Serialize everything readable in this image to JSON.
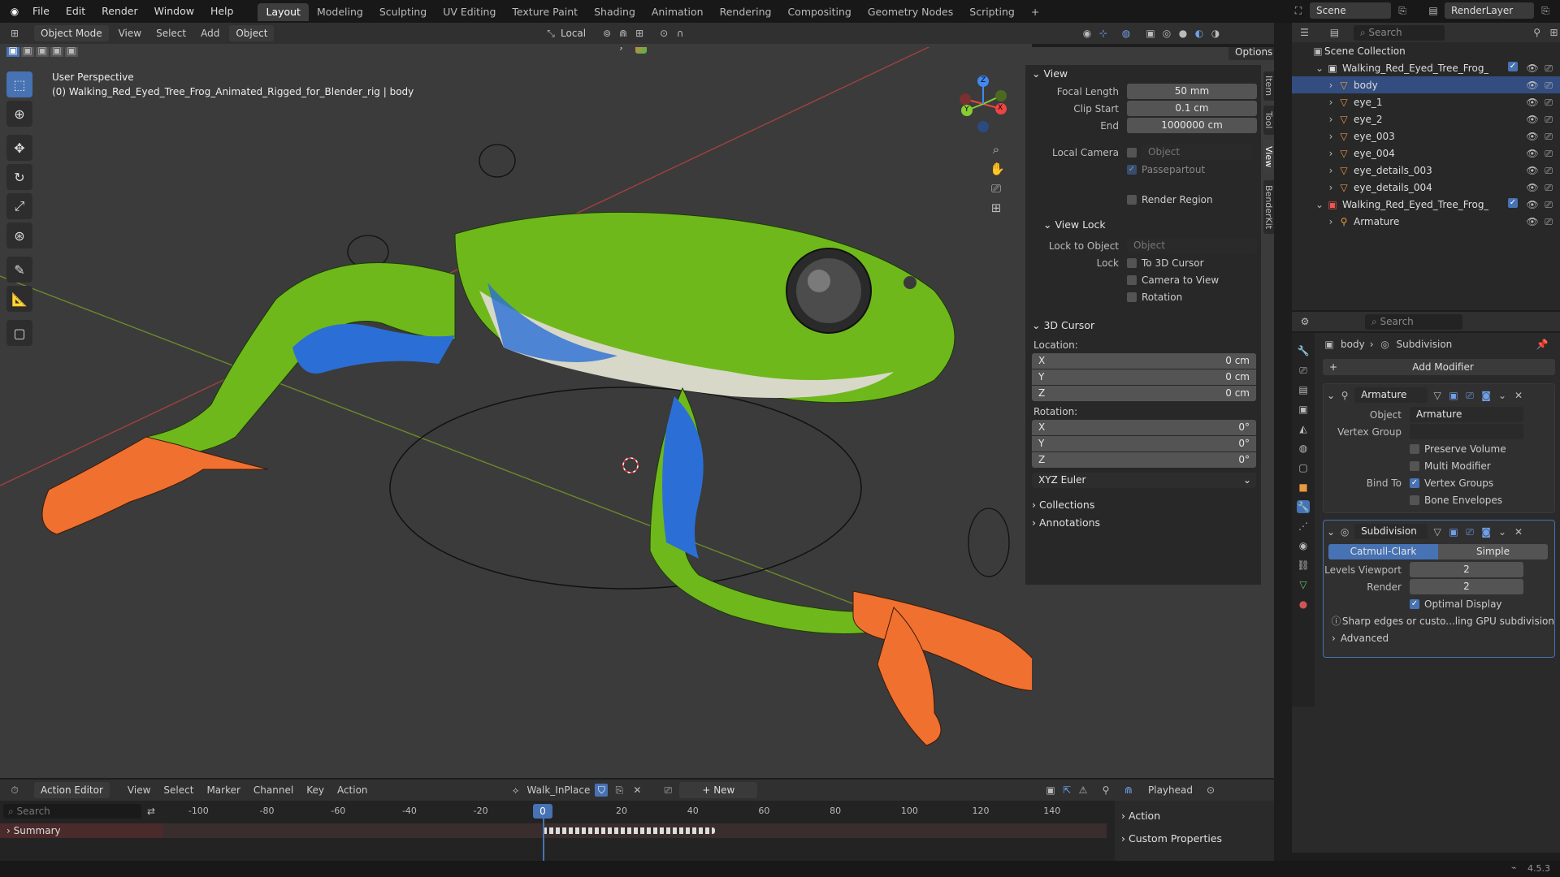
{
  "topbar": {
    "menus": [
      "File",
      "Edit",
      "Render",
      "Window",
      "Help"
    ],
    "workspaces": [
      "Layout",
      "Modeling",
      "Sculpting",
      "UV Editing",
      "Texture Paint",
      "Shading",
      "Animation",
      "Rendering",
      "Compositing",
      "Geometry Nodes",
      "Scripting"
    ],
    "active_workspace": "Layout",
    "add_tab": "+",
    "scene": "Scene",
    "view_layer": "RenderLayer"
  },
  "viewport_header": {
    "mode": "Object Mode",
    "menus": [
      "View",
      "Select",
      "Add",
      "Object"
    ],
    "active_menu": "Object",
    "transform_orientation": "Local",
    "options": "Options"
  },
  "viewport": {
    "perspective": "User Perspective",
    "object_info": "(0) Walking_Red_Eyed_Tree_Frog_Animated_Rigged_for_Blender_rig | body",
    "gizmo_axes": [
      "X",
      "Y",
      "Z"
    ]
  },
  "npanel": {
    "tabs": [
      "Item",
      "Tool",
      "View",
      "BenderKit"
    ],
    "view": {
      "title": "View",
      "focal_length_label": "Focal Length",
      "focal_length": "50 mm",
      "clip_start_label": "Clip Start",
      "clip_start": "0.1 cm",
      "end_label": "End",
      "end": "1000000 cm",
      "local_camera_label": "Local Camera",
      "object_placeholder": "Object",
      "passepartout": "Passepartout",
      "render_region": "Render Region"
    },
    "view_lock": {
      "title": "View Lock",
      "lock_to_object_label": "Lock to Object",
      "object_placeholder": "Object",
      "lock_label": "Lock",
      "to_3d_cursor": "To 3D Cursor",
      "camera_to_view": "Camera to View",
      "rotation": "Rotation"
    },
    "cursor": {
      "title": "3D Cursor",
      "location_label": "Location:",
      "loc": [
        {
          "axis": "X",
          "value": "0 cm"
        },
        {
          "axis": "Y",
          "value": "0 cm"
        },
        {
          "axis": "Z",
          "value": "0 cm"
        }
      ],
      "rotation_label": "Rotation:",
      "rot": [
        {
          "axis": "X",
          "value": "0°"
        },
        {
          "axis": "Y",
          "value": "0°"
        },
        {
          "axis": "Z",
          "value": "0°"
        }
      ],
      "rotation_mode": "XYZ Euler"
    },
    "collections": "Collections",
    "annotations": "Annotations"
  },
  "outliner": {
    "search_placeholder": "Search",
    "scene_collection": "Scene Collection",
    "items": [
      {
        "name": "Walking_Red_Eyed_Tree_Frog_Anima",
        "level": 1,
        "type": "collection"
      },
      {
        "name": "body",
        "level": 2,
        "type": "mesh",
        "selected": true
      },
      {
        "name": "eye_1",
        "level": 2,
        "type": "mesh"
      },
      {
        "name": "eye_2",
        "level": 2,
        "type": "mesh"
      },
      {
        "name": "eye_003",
        "level": 2,
        "type": "mesh"
      },
      {
        "name": "eye_004",
        "level": 2,
        "type": "mesh"
      },
      {
        "name": "eye_details_003",
        "level": 2,
        "type": "mesh"
      },
      {
        "name": "eye_details_004",
        "level": 2,
        "type": "mesh"
      },
      {
        "name": "Walking_Red_Eyed_Tree_Frog_Anima",
        "level": 1,
        "type": "collection-red"
      },
      {
        "name": "Armature",
        "level": 2,
        "type": "armature"
      }
    ]
  },
  "properties": {
    "search_placeholder": "Search",
    "breadcrumb_object": "body",
    "breadcrumb_modifier": "Subdivision",
    "add_modifier": "Add Modifier",
    "armature_mod": {
      "name": "Armature",
      "object_label": "Object",
      "object_value": "Armature",
      "vertex_group_label": "Vertex Group",
      "preserve_volume": "Preserve Volume",
      "multi_modifier": "Multi Modifier",
      "bind_to_label": "Bind To",
      "vertex_groups": "Vertex Groups",
      "bone_envelopes": "Bone Envelopes"
    },
    "subdivision_mod": {
      "name": "Subdivision",
      "catmull": "Catmull-Clark",
      "simple": "Simple",
      "levels_viewport_label": "Levels Viewport",
      "levels_viewport": "2",
      "render_label": "Render",
      "render": "2",
      "optimal_display": "Optimal Display",
      "warning": "Sharp edges or custo...ling GPU subdivision",
      "advanced": "Advanced"
    }
  },
  "timeline": {
    "editor_type": "Action Editor",
    "menus": [
      "View",
      "Select",
      "Marker",
      "Channel",
      "Key",
      "Action"
    ],
    "action_name": "Walk_InPlace",
    "new": "New",
    "playhead": "Playhead",
    "search_placeholder": "Search",
    "summary": "Summary",
    "frames": [
      "-100",
      "-80",
      "-60",
      "-40",
      "-20",
      "0",
      "20",
      "40",
      "60",
      "80",
      "100",
      "120",
      "140"
    ],
    "current_frame": "0",
    "side": [
      "Action",
      "Custom Properties"
    ]
  },
  "status": {
    "version": "4.5.3"
  }
}
